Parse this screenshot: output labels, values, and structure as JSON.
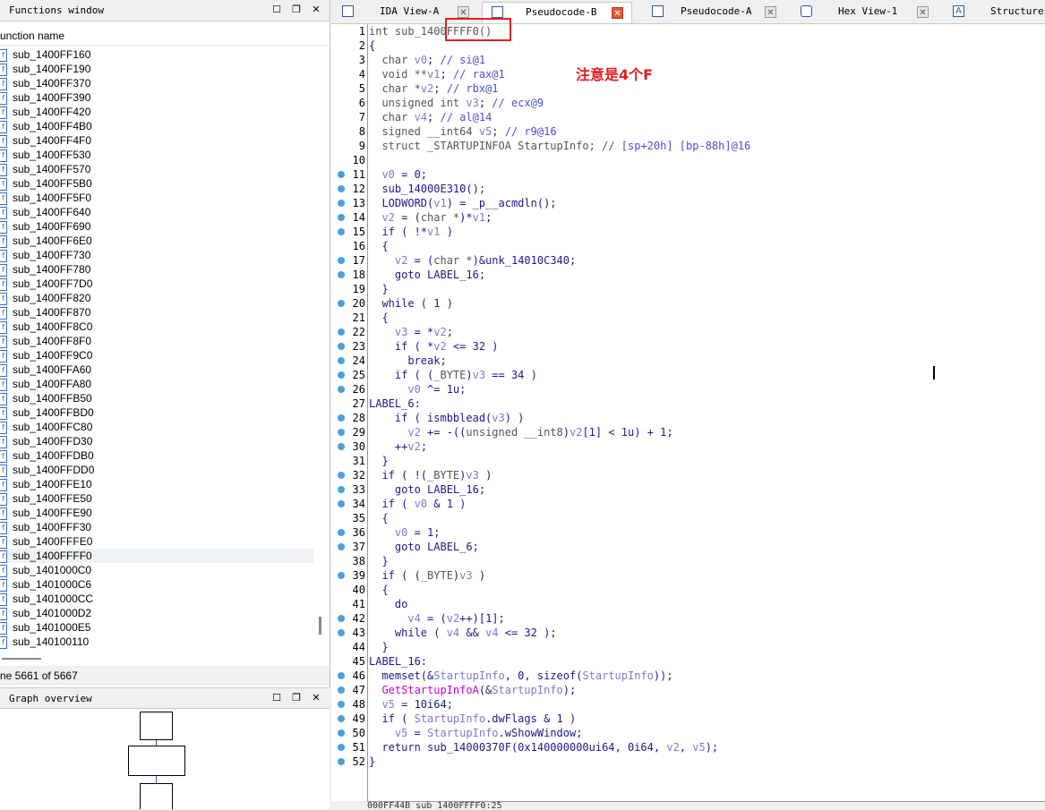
{
  "functions_window": {
    "title": "Functions window",
    "column_header": "unction name",
    "items": [
      "sub_1400FF160",
      "sub_1400FF190",
      "sub_1400FF370",
      "sub_1400FF390",
      "sub_1400FF420",
      "sub_1400FF4B0",
      "sub_1400FF4F0",
      "sub_1400FF530",
      "sub_1400FF570",
      "sub_1400FF5B0",
      "sub_1400FF5F0",
      "sub_1400FF640",
      "sub_1400FF690",
      "sub_1400FF6E0",
      "sub_1400FF730",
      "sub_1400FF780",
      "sub_1400FF7D0",
      "sub_1400FF820",
      "sub_1400FF870",
      "sub_1400FF8C0",
      "sub_1400FF8F0",
      "sub_1400FF9C0",
      "sub_1400FFA60",
      "sub_1400FFA80",
      "sub_1400FFB50",
      "sub_1400FFBD0",
      "sub_1400FFC80",
      "sub_1400FFD30",
      "sub_1400FFDB0",
      "sub_1400FFDD0",
      "sub_1400FFE10",
      "sub_1400FFE50",
      "sub_1400FFE90",
      "sub_1400FFF30",
      "sub_1400FFFE0",
      "sub_1400FFFF0",
      "sub_1401000C0",
      "sub_1401000C6",
      "sub_1401000CC",
      "sub_1401000D2",
      "sub_1401000E5",
      "sub_140100110"
    ],
    "selected_index": 35,
    "status": "ne 5661 of 5667"
  },
  "graph_overview": {
    "title": "Graph overview"
  },
  "tabs": [
    {
      "label": "IDA View-A",
      "active": false
    },
    {
      "label": "Pseudocode-B",
      "active": true
    },
    {
      "label": "Pseudocode-A",
      "active": false
    },
    {
      "label": "Hex View-1",
      "active": false
    },
    {
      "label": "Structures",
      "active": false
    }
  ],
  "annotation": "注意是4个F",
  "code_status": "000FF44B sub_1400FFFF0:25",
  "code_lines": [
    {
      "n": "1",
      "dot": false,
      "html": "<span class='gray'>int sub_1400FFFF0()</span>"
    },
    {
      "n": "2",
      "dot": false,
      "html": "{"
    },
    {
      "n": "3",
      "dot": false,
      "html": "  <span class='gray'>char</span> <span class='v'>v0</span>; <span class='cm'>// si@1</span>"
    },
    {
      "n": "4",
      "dot": false,
      "html": "  <span class='gray'>void **</span><span class='v'>v1</span>; <span class='cm'>// rax@1</span>"
    },
    {
      "n": "5",
      "dot": false,
      "html": "  <span class='gray'>char *</span><span class='v'>v2</span>; <span class='cm'>// rbx@1</span>"
    },
    {
      "n": "6",
      "dot": false,
      "html": "  <span class='gray'>unsigned int</span> <span class='v'>v3</span>; <span class='cm'>// ecx@9</span>"
    },
    {
      "n": "7",
      "dot": false,
      "html": "  <span class='gray'>char</span> <span class='v'>v4</span>; <span class='cm'>// al@14</span>"
    },
    {
      "n": "8",
      "dot": false,
      "html": "  <span class='gray'>signed __int64</span> <span class='v'>v5</span>; <span class='cm'>// r9@16</span>"
    },
    {
      "n": "9",
      "dot": false,
      "html": "  <span class='gray'>struct _STARTUPINFOA StartupInfo;</span> <span class='cm'>// [sp+20h] [bp-88h]@16</span>"
    },
    {
      "n": "10",
      "dot": false,
      "html": ""
    },
    {
      "n": "11",
      "dot": true,
      "html": "  <span class='v'>v0</span> = 0;"
    },
    {
      "n": "12",
      "dot": true,
      "html": "  sub_14000E310();"
    },
    {
      "n": "13",
      "dot": true,
      "html": "  LODWORD(<span class='v'>v1</span>) = _p__acmdln();"
    },
    {
      "n": "14",
      "dot": true,
      "html": "  <span class='v'>v2</span> = (<span class='gray'>char *</span>)*<span class='v'>v1</span>;"
    },
    {
      "n": "15",
      "dot": true,
      "html": "  if ( !*<span class='v'>v1</span> )"
    },
    {
      "n": "16",
      "dot": false,
      "html": "  {"
    },
    {
      "n": "17",
      "dot": true,
      "html": "    <span class='v'>v2</span> = (<span class='gray'>char *</span>)&amp;unk_14010C340;"
    },
    {
      "n": "18",
      "dot": true,
      "html": "    goto LABEL_16;"
    },
    {
      "n": "19",
      "dot": false,
      "html": "  }"
    },
    {
      "n": "20",
      "dot": true,
      "html": "  while ( 1 )"
    },
    {
      "n": "21",
      "dot": false,
      "html": "  {"
    },
    {
      "n": "22",
      "dot": true,
      "html": "    <span class='v'>v3</span> = *<span class='v'>v2</span>;"
    },
    {
      "n": "23",
      "dot": true,
      "html": "    if ( *<span class='v'>v2</span> &lt;= 32 )"
    },
    {
      "n": "24",
      "dot": true,
      "html": "      break;"
    },
    {
      "n": "25",
      "dot": true,
      "html": "    if ( (<span class='gray'>_BYTE</span>)<span class='v'>v3</span> == 34 )"
    },
    {
      "n": "26",
      "dot": true,
      "html": "      <span class='v'>v0</span> ^= 1u;"
    },
    {
      "n": "27",
      "dot": false,
      "html": "LABEL_6:"
    },
    {
      "n": "28",
      "dot": true,
      "html": "    if ( ismbblead(<span class='v'>v3</span>) )"
    },
    {
      "n": "29",
      "dot": true,
      "html": "      <span class='v'>v2</span> += -((<span class='gray'>unsigned __int8</span>)<span class='v'>v2</span>[1] &lt; 1u) + 1;"
    },
    {
      "n": "30",
      "dot": true,
      "html": "    ++<span class='v'>v2</span>;"
    },
    {
      "n": "31",
      "dot": false,
      "html": "  }"
    },
    {
      "n": "32",
      "dot": true,
      "html": "  if ( !(<span class='gray'>_BYTE</span>)<span class='v'>v3</span> )"
    },
    {
      "n": "33",
      "dot": true,
      "html": "    goto LABEL_16;"
    },
    {
      "n": "34",
      "dot": true,
      "html": "  if ( <span class='v'>v0</span> &amp; 1 )"
    },
    {
      "n": "35",
      "dot": false,
      "html": "  {"
    },
    {
      "n": "36",
      "dot": true,
      "html": "    <span class='v'>v0</span> = 1;"
    },
    {
      "n": "37",
      "dot": true,
      "html": "    goto LABEL_6;"
    },
    {
      "n": "38",
      "dot": false,
      "html": "  }"
    },
    {
      "n": "39",
      "dot": true,
      "html": "  if ( (<span class='gray'>_BYTE</span>)<span class='v'>v3</span> )"
    },
    {
      "n": "40",
      "dot": false,
      "html": "  {"
    },
    {
      "n": "41",
      "dot": false,
      "html": "    do"
    },
    {
      "n": "42",
      "dot": true,
      "html": "      <span class='v'>v4</span> = (<span class='v'>v2</span>++)[1];"
    },
    {
      "n": "43",
      "dot": true,
      "html": "    while ( <span class='v'>v4</span> &amp;&amp; <span class='v'>v4</span> &lt;= 32 );"
    },
    {
      "n": "44",
      "dot": false,
      "html": "  }"
    },
    {
      "n": "45",
      "dot": false,
      "html": "LABEL_16:"
    },
    {
      "n": "46",
      "dot": true,
      "html": "  memset(&amp;<span class='v'>StartupInfo</span>, 0, sizeof(<span class='v'>StartupInfo</span>));"
    },
    {
      "n": "47",
      "dot": true,
      "html": "  <span class='pk'>GetStartupInfoA</span>(&amp;<span class='v'>StartupInfo</span>);"
    },
    {
      "n": "48",
      "dot": true,
      "html": "  <span class='v'>v5</span> = 10i64;"
    },
    {
      "n": "49",
      "dot": true,
      "html": "  if ( <span class='v'>StartupInfo</span>.dwFlags &amp; 1 )"
    },
    {
      "n": "50",
      "dot": true,
      "html": "    <span class='v'>v5</span> = <span class='v'>StartupInfo</span>.wShowWindow;"
    },
    {
      "n": "51",
      "dot": true,
      "html": "  return sub_14000370F(0x140000000ui64, 0i64, <span class='v'>v2</span>, <span class='v'>v5</span>);"
    },
    {
      "n": "52",
      "dot": true,
      "html": "}"
    }
  ],
  "colors": {
    "accent_red": "#e02020",
    "breakpoint_dot": "#4aa0e0",
    "code_keyword": "#1a1a8a",
    "code_var": "#7a7ad0",
    "api_call": "#cc00cc"
  }
}
